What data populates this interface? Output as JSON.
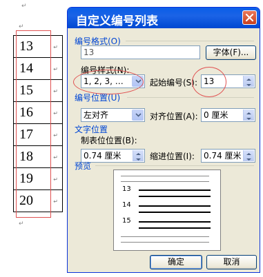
{
  "document": {
    "numbers": [
      "13",
      "14",
      "15",
      "16",
      "17",
      "18",
      "19",
      "20"
    ],
    "para_mark": "↵",
    "cell_mark": "↵"
  },
  "dialog": {
    "title": "自定义编号列表",
    "format_group": "编号格式(O)",
    "format_value": "13",
    "font_button": "字体(F)...",
    "style_label": "编号样式(N):",
    "style_value": "1, 2, 3, …",
    "start_label": "起始编号(S):",
    "start_value": "13",
    "position_group": "编号位置(U)",
    "align_value": "左对齐",
    "align_pos_label": "对齐位置(A):",
    "align_pos_value": "0 厘米",
    "text_group": "文字位置",
    "tab_label": "制表位位置(B):",
    "tab_value": "0.74 厘米",
    "indent_label": "缩进位置(I):",
    "indent_value": "0.74 厘米",
    "preview_label": "预览",
    "preview_numbers": [
      "13",
      "14",
      "15"
    ],
    "ok_button": "确定",
    "cancel_button": "取消"
  },
  "colors": {
    "title_bar": "#0a5ee8",
    "group_label": "#0046d5",
    "highlight": "#e05050",
    "dialog_bg": "#ece9d8"
  }
}
